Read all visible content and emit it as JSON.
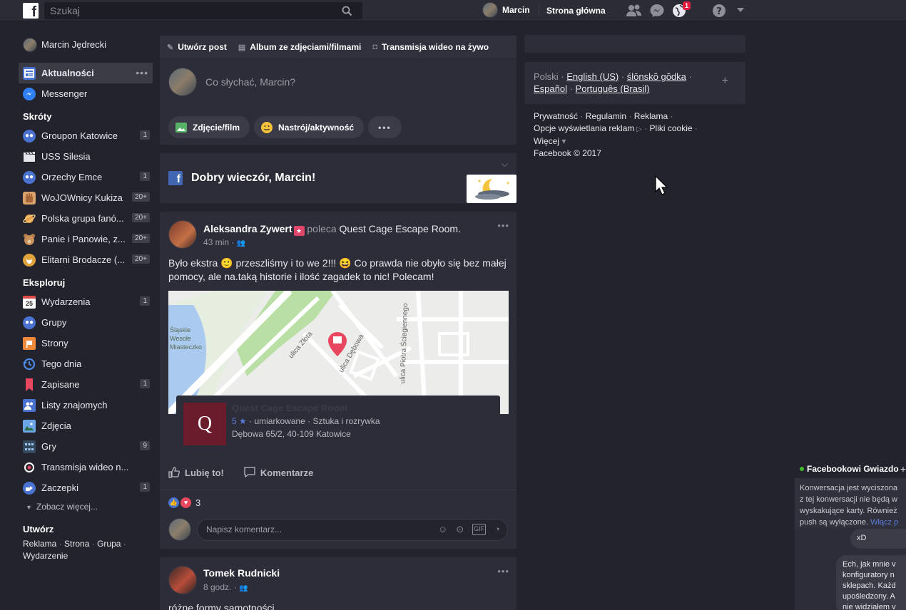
{
  "topbar": {
    "search_placeholder": "Szukaj",
    "user_name": "Marcin",
    "home_label": "Strona główna",
    "notifications_badge": "1"
  },
  "sidebar": {
    "profile_name": "Marcin Jędrecki",
    "main_items": [
      {
        "label": "Aktualności",
        "icon": "news-feed-icon",
        "active": true
      },
      {
        "label": "Messenger",
        "icon": "messenger-icon"
      }
    ],
    "shortcuts_heading": "Skróty",
    "shortcuts": [
      {
        "label": "Groupon Katowice",
        "count": "1",
        "icon": "group-icon"
      },
      {
        "label": "USS Silesia",
        "count": "",
        "icon": "clapper-icon"
      },
      {
        "label": "Orzechy Emce",
        "count": "1",
        "icon": "group-icon"
      },
      {
        "label": "WoJOWnicy Kukiza",
        "count": "20+",
        "icon": "fist-icon"
      },
      {
        "label": "Polska grupa fanó...",
        "count": "20+",
        "icon": "planet-icon"
      },
      {
        "label": "Panie i Panowie, z...",
        "count": "20+",
        "icon": "teddy-bear-icon"
      },
      {
        "label": "Elitarni Brodacze (...",
        "count": "20+",
        "icon": "beard-icon"
      }
    ],
    "explore_heading": "Eksploruj",
    "explore": [
      {
        "label": "Wydarzenia",
        "count": "1",
        "icon": "calendar-icon",
        "icon_text": "25"
      },
      {
        "label": "Grupy",
        "count": "",
        "icon": "groups-icon"
      },
      {
        "label": "Strony",
        "count": "",
        "icon": "flag-icon"
      },
      {
        "label": "Tego dnia",
        "count": "",
        "icon": "clock-history-icon"
      },
      {
        "label": "Zapisane",
        "count": "1",
        "icon": "bookmark-icon"
      },
      {
        "label": "Listy znajomych",
        "count": "",
        "icon": "friends-list-icon"
      },
      {
        "label": "Zdjęcia",
        "count": "",
        "icon": "photo-icon"
      },
      {
        "label": "Gry",
        "count": "9",
        "icon": "games-icon"
      },
      {
        "label": "Transmisja wideo n...",
        "count": "",
        "icon": "live-video-icon"
      },
      {
        "label": "Zaczepki",
        "count": "1",
        "icon": "poke-icon"
      }
    ],
    "see_more": "Zobacz więcej...",
    "create_heading": "Utwórz",
    "create_links": [
      "Reklama",
      "Strona",
      "Grupa",
      "Wydarzenie"
    ]
  },
  "composer": {
    "tabs": [
      "Utwórz post",
      "Album ze zdjęciami/filmami",
      "Transmisja wideo na żywo"
    ],
    "placeholder": "Co słychać, Marcin?",
    "actions": [
      "Zdjęcie/film",
      "Nastrój/aktywność"
    ]
  },
  "greeting": {
    "text": "Dobry wieczór, Marcin!"
  },
  "post": {
    "author": "Aleksandra Zywert",
    "recommends": "poleca",
    "place": "Quest Cage Escape Room.",
    "time": "43 min",
    "text": "Było ekstra 🙂 przeszliśmy i to we 2!!! 😆 Co prawda nie obyło się bez małej pomocy, ale na.taką historie i ilość zagadek to nic! Polecam!",
    "map_labels": {
      "street1": "ulica Złota",
      "street2": "ulica Dębowa",
      "street3": "ulica Piotra Ściegiennego",
      "park_line1": "Śląskie",
      "park_line2": "Wesołe",
      "park_line3": "Miasteczko"
    },
    "place_card": {
      "name": "Quest Cage Escape Room",
      "logo_letter": "Q",
      "rating": "5",
      "rating_star": "★",
      "price": "umiarkowane",
      "category": "Sztuka i rozrywka",
      "address": "Dębowa 65/2, 40-109 Katowice"
    },
    "like_label": "Lubię to!",
    "comment_label": "Komentarze",
    "reactions_count": "3",
    "comment_placeholder": "Napisz komentarz..."
  },
  "post2": {
    "author": "Tomek Rudnicki",
    "time": "8 godz.",
    "text": "różne formy samotności"
  },
  "right_column": {
    "languages": [
      "Polski",
      "English (US)",
      "ślōnskŏ gŏdka",
      "Español",
      "Português (Brasil)"
    ],
    "footer_links": [
      "Prywatność",
      "Regulamin",
      "Reklama",
      "Opcje wyświetlania reklam",
      "Pliki cookie",
      "Więcej"
    ],
    "copyright": "Facebook © 2017"
  },
  "chat": {
    "title": "Facebookowi Gwiazdo",
    "warning_lines": [
      "Konwersacja jest wyciszona",
      "z tej konwersacji nie będą w",
      "wyskakujące karty. Również",
      "push są wyłączone."
    ],
    "warning_link": "Włącz p",
    "message1": "xD",
    "message2_lines": [
      "Ech, jak mnie v",
      "konfiguratory n",
      "sklepach. Każd",
      "upośledzony. A",
      "nie widziałem v"
    ]
  },
  "colors": {
    "background": "#22232c",
    "card": "#2c2d38",
    "topbar": "#2b2c36",
    "accent_blue": "#4267b2",
    "notification_red": "#e41e3f",
    "online_green": "#42b72a"
  }
}
